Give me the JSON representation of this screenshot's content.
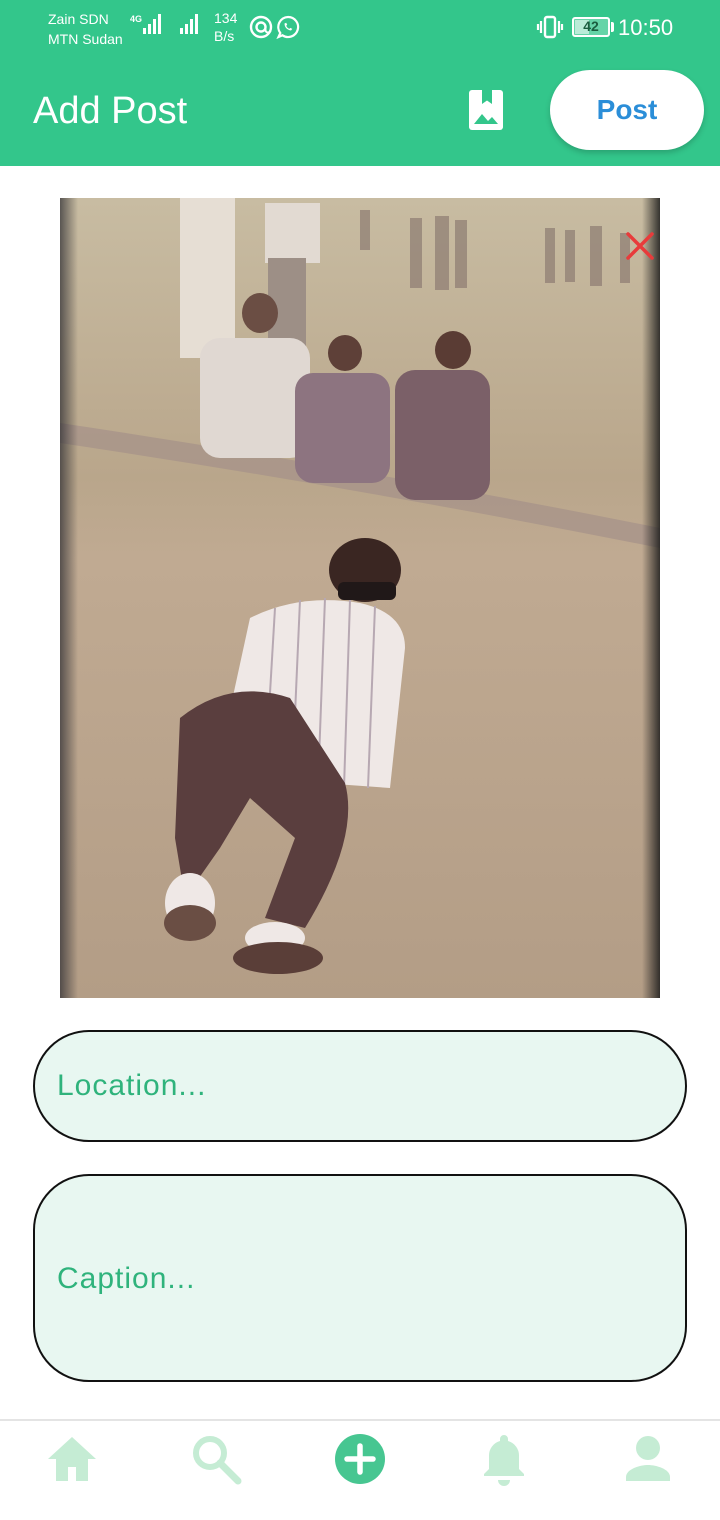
{
  "status_bar": {
    "carrier_1": "Zain SDN",
    "carrier_2": "MTN Sudan",
    "network_tag": "4G",
    "net_speed_value": "134",
    "net_speed_unit": "B/s",
    "battery_level": "42",
    "time": "10:50",
    "icons": [
      "signal-icon",
      "signal-icon",
      "at-sign-icon",
      "whatsapp-icon",
      "vibrate-icon",
      "battery-icon"
    ]
  },
  "app_bar": {
    "title": "Add Post",
    "bookmark_icon": "bookmark-image-icon",
    "post_label": "Post"
  },
  "photo": {
    "close_icon": "close-icon"
  },
  "form": {
    "location_placeholder": "Location...",
    "caption_placeholder": "Caption..."
  },
  "bottom_nav": {
    "items": [
      {
        "icon": "home-icon"
      },
      {
        "icon": "search-icon"
      },
      {
        "icon": "add-circle-icon"
      },
      {
        "icon": "bell-icon"
      },
      {
        "icon": "person-icon"
      }
    ]
  },
  "colors": {
    "primary_green": "#33c68b",
    "post_text_blue": "#2b8ed8",
    "close_red": "#e83b3b",
    "nav_inactive": "#c5ecd4",
    "nav_active": "#47c691",
    "field_bg": "#e8f7f1"
  }
}
